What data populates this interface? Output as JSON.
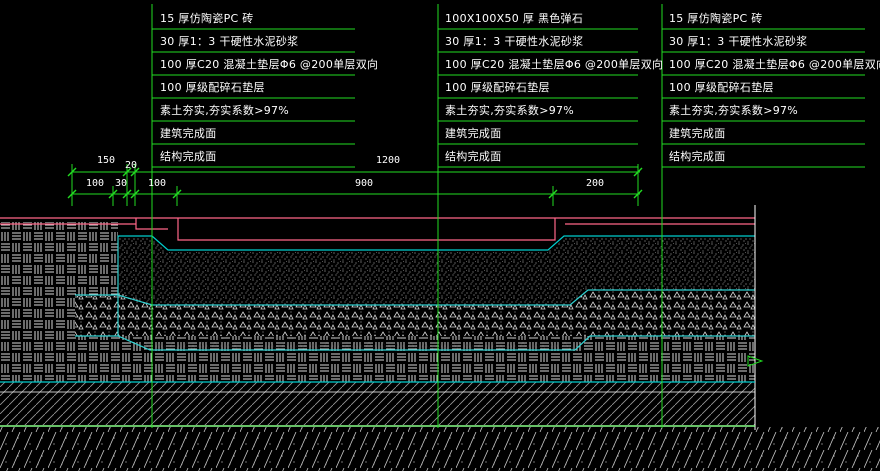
{
  "callouts": [
    {
      "lines": [
        "15 厚仿陶瓷PC 砖",
        "30 厚1：3 干硬性水泥砂浆",
        "100  厚C20  混凝土垫层Φ6 @200单层双向",
        "100  厚级配碎石垫层",
        "素土夯实,夯实系数>97%",
        "建筑完成面",
        "结构完成面"
      ]
    },
    {
      "lines": [
        "100X100X50      厚 黑色弹石",
        "30 厚1：3 干硬性水泥砂浆",
        "100  厚C20  混凝土垫层Φ6 @200单层双向",
        "100  厚级配碎石垫层",
        "素土夯实,夯实系数>97%",
        "建筑完成面",
        "结构完成面"
      ]
    },
    {
      "lines": [
        "15 厚仿陶瓷PC 砖",
        "30 厚1：3 干硬性水泥砂浆",
        "100  厚C20  混凝土垫层Φ6 @200单层双向",
        "100  厚级配碎石垫层",
        "素土夯实,夯实系数>97%",
        "建筑完成面",
        "结构完成面"
      ]
    }
  ],
  "dimensions": {
    "top_row": [
      "150",
      "20",
      "1200"
    ],
    "bottom_row": [
      "100",
      "30",
      "100",
      "900",
      "200"
    ]
  },
  "colors": {
    "leader": "#22dd22",
    "paving": "#ff6688",
    "mortar": "#00cccc",
    "concrete": "#2fd0d0",
    "hatch": "#ffffff",
    "ground": "#88ff88"
  }
}
